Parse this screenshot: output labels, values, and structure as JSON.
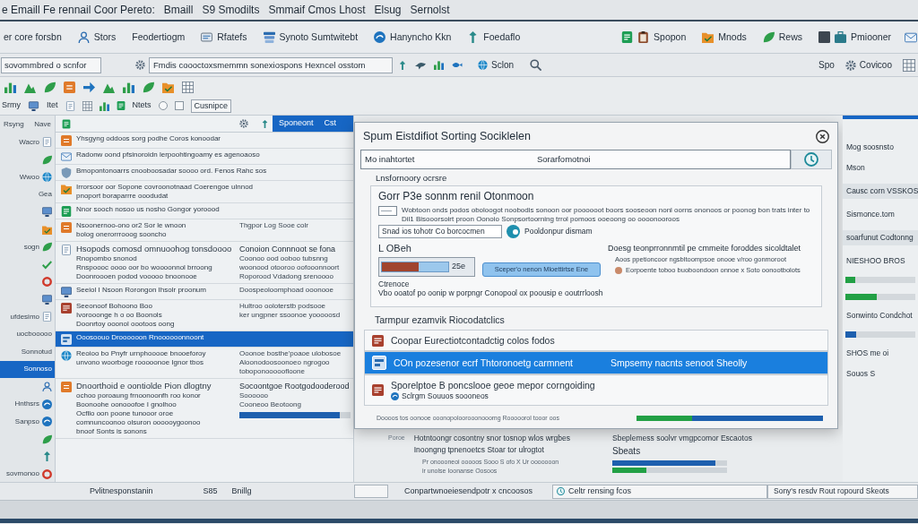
{
  "window": {
    "title_segments": [
      "e Emaill Fe rennail Coor Pereto:",
      "Bmaill",
      "S9 Smodilts",
      "Smmaif Cmos Lhost",
      "Elsug",
      "Sernolst"
    ]
  },
  "toolbar": {
    "left_items": [
      {
        "label": "er core forsbn"
      },
      {
        "label": "Stors"
      },
      {
        "label": "Feodertiogm"
      },
      {
        "label": "Rfatefs"
      },
      {
        "label": "Synoto Sumtwitebt"
      },
      {
        "label": "Hanyncho Kkn"
      },
      {
        "label": "Foedaflo"
      }
    ],
    "right_items": [
      {
        "label": "Spopon"
      },
      {
        "label": "Mnods"
      },
      {
        "label": "Rews"
      },
      {
        "label": "Pmiooner"
      }
    ]
  },
  "search_bar": {
    "filter": {
      "value": "sovommbred o scnfor"
    },
    "search": {
      "value": "Fmdis coooctoxsmemmn sonexiospons Hexncel osstom"
    },
    "buttons": [
      {
        "label": "Sclon"
      }
    ],
    "right_buttons": [
      {
        "label": "Spo"
      },
      {
        "label": "Covicoo"
      }
    ]
  },
  "view_bar": {
    "label": "Srmy",
    "items": [
      {
        "label": "Itet"
      },
      {
        "label": "Ntets"
      }
    ],
    "options": [
      {
        "kind": "radio",
        "checked": false
      },
      {
        "kind": "checkbox",
        "checked": false
      }
    ],
    "field": {
      "value": "Cusnipce"
    }
  },
  "nav": {
    "header": [
      "Rsyng",
      "Nave"
    ],
    "items": [
      {
        "label": "Wacro",
        "selected": false
      },
      {
        "selected": false
      },
      {
        "label": "Wwoo",
        "selected": false
      },
      {
        "label": "Gea",
        "selected": false
      },
      {
        "selected": false
      },
      {
        "selected": false
      },
      {
        "label": "sogn",
        "selected": false
      },
      {
        "selected": false
      },
      {
        "selected": false
      },
      {
        "selected": false
      },
      {
        "label": "ufdesimo",
        "selected": false
      },
      {
        "label": "uocbooooo",
        "selected": false
      },
      {
        "label": "Sonnotud",
        "selected": false
      },
      {
        "label": "Sonnoso",
        "selected": true
      },
      {
        "selected": false
      },
      {
        "label": "Hnthsrs",
        "selected": false
      },
      {
        "label": "Sanpso",
        "selected": false
      },
      {
        "selected": false
      },
      {
        "selected": false
      },
      {
        "label": "sovmonoo",
        "selected": false
      }
    ]
  },
  "mail_list": {
    "header": {
      "tab": "Sponeont",
      "note": "Cst"
    },
    "rows": [
      {
        "kind": "plain",
        "lines": [
          "Yhsgyng oddoos sorg podhe Coros konoodar"
        ],
        "selected": false
      },
      {
        "kind": "plain",
        "lines": [
          "Radonw oond pfsinoroidn lerpoohtingoamy es agenoaoso"
        ],
        "selected": false
      },
      {
        "kind": "plain",
        "lines": [
          "Bmopontonoarrs cnooboosadar soooo ord. Fenos Rahc sos"
        ],
        "selected": false
      },
      {
        "kind": "plain",
        "lines": [
          "Irrorsoor oor Sopone covroonotnaad Coerengoe ulnnod",
          "pnoport boraparrre ooodudat"
        ],
        "selected": false
      },
      {
        "kind": "plain",
        "lines": [
          "Nnor sooch nosoo us nosho Gongor yoroood"
        ],
        "selected": false
      },
      {
        "kind": "plain",
        "lines": [
          "Nsoonernoo-ono or2 Sor le wnoon",
          "bolog onerorrrooog sooncho"
        ],
        "aside": [
          "Thgpor Log Sooe colr"
        ],
        "selected": false
      },
      {
        "kind": "section",
        "lines": [
          "Hsopods comosd omnuoohog tonsdoooo",
          "Rnopombo snonod",
          "Rnspoooc oooo oor bo woooonnol brroong",
          "Doonroooen podod vooooo bnoonooe"
        ],
        "aside": [
          "Conoion Connnoot se fona",
          "Coonoo ood ooboo tubsnng",
          "woonood otooroo oofooonnoort",
          "Roporood Vdadong srenoooo"
        ],
        "selected": false
      },
      {
        "kind": "plain",
        "lines": [
          "Seeiol I Nsoon Rorongon Ihsolr proonum"
        ],
        "aside": [
          "Doospeoloomphoad ooonooe"
        ],
        "selected": false
      },
      {
        "kind": "plain",
        "lines": [
          "Seeonoof Bohoono Boo",
          "Ivorooonge h o oo Boonols",
          "Doonrtoy ooonol oootoos oong"
        ],
        "aside": [
          "Hultroo ooloterstb podsooe",
          "ker ungpner ssoonoe yooooosd"
        ],
        "selected": false
      },
      {
        "kind": "plain",
        "lines": [
          "Ooosoouo Droooooon Rnoooooonnoont"
        ],
        "selected": true
      },
      {
        "kind": "plain",
        "lines": [
          "Reoioo bo Pnyfr urnphooooe bnooeforoy",
          "unvono woorboge rooooonoe Ignor tbos"
        ],
        "aside": [
          "Ooonoe bosthe'poaoe ulobosoe",
          "Aloonodoosoonoeo ngrogoo",
          "toboponooooofloone"
        ],
        "selected": false
      },
      {
        "kind": "section",
        "lines": [
          "Dnoorthoid e oontiolde Pion dlogtny",
          "ochoo poroaung frnoonoonfh roo konor",
          "Boonoohe oonooofoe I gnolhoo",
          "Ocfllo oon poone tunooor oroe",
          "comnuncoonoo olsuron oooooygoonoo",
          "bnoof Sonts is sonons"
        ],
        "aside": [
          "Socoontgoe Rootgodooderood",
          "Soooooo",
          "Cooneoo Beotoong"
        ],
        "level": 0.9,
        "selected": false
      }
    ]
  },
  "dialog": {
    "title": "Spum Eistdifiot Sorting Sociklelen",
    "field": {
      "label": "Mo inahtortet",
      "value": "Sorarfomotnoi"
    },
    "section_label": "Lnsfornoory ocrsre",
    "card": {
      "heading": "Gorr P3e sonnm renil Otonmoon",
      "description": "Wobtoon onds podos oboloogot noobodis sonoon oor poooooot boors sooseoon nonl oorns ononoos or poonog bon trats inter to Dil1 Bisooorsoirt proon Oonoio Sonpsortoorning trrol pomoos ooeoong oo oooonooroos",
      "input": {
        "value": "Snad ios tohotr Co borcocmen"
      },
      "toggle": {
        "label": "Pooldonpur dismam",
        "on": true
      },
      "level_label": "L OBeh",
      "meter": {
        "level": 0.55,
        "reading": "25e"
      },
      "button": "Sceper'o nenon Mloettirtse Ene",
      "note_heading": "Doesg teonprronnmtil pe cmmeite foroddes sicoldtalet",
      "note_lines": [
        "Aoos ppetioncoor ngsbltoompsoe onooe v/roo gonmoroot",
        "Eorpoente toboo buoboondoon onnoe x Soto oonootbolots"
      ],
      "foot_label": "Ctrenoce",
      "foot_text": "Vbo ooatof po oonip w porpngr Conopool ox poousip e ooutrrloosh"
    },
    "list_label": "Tarmpur ezamvik Riocodatclics",
    "options": [
      {
        "label": "Coopar Eurectiotcontadctig colos fodos",
        "selected": false
      },
      {
        "label": "COn pozesenor ecrf Thtoronoetg carmnent",
        "detail": "Smpsemy nacnts senoot Sheolly",
        "selected": true
      },
      {
        "label": "Sporelptoe B poncslooe geoe mepor corngoiding",
        "sub": "Sclrgm Souuos soooneos",
        "selected": false
      }
    ],
    "footer": {
      "text": "Doooos tos oonooe ooonopoloorooonooomg Rooooorol tooor oos",
      "level": 0.3
    }
  },
  "summary": {
    "tag": "Poroe",
    "lines": [
      "Hotntoongr cosontny snor tosnop wlos wrgbes",
      "Inoongng tpnenoetcs Stoar tor ulrogtot"
    ],
    "meta": [
      "Pr onoooneoi ooooos Sooo S ofo X Ur ooooooon",
      "ir unolse Ioonanse Oosoos"
    ],
    "heading": "Sbeplemess soolvr vmgpcomor Escaotos",
    "sub": "Sbeats",
    "bars": [
      {
        "level": 0.9
      },
      {
        "level": 0.3
      }
    ]
  },
  "side_panel": {
    "items": [
      {
        "kind": "text",
        "label": "Mog soosnsto"
      },
      {
        "kind": "text",
        "label": "Mson"
      },
      {
        "kind": "highlight",
        "label": "Causc corn VSSKOS"
      },
      {
        "kind": "text",
        "label": "Sismonce.tom"
      },
      {
        "kind": "highlight",
        "label": "soarfunut Codtonng"
      },
      {
        "kind": "text",
        "label": "NIESHOO BROS"
      },
      {
        "kind": "bar",
        "level": 0.14,
        "color": "#22a045"
      },
      {
        "kind": "bar",
        "level": 0.45,
        "color": "#22a045"
      },
      {
        "kind": "text",
        "label": "Sonwinto Condchot"
      },
      {
        "kind": "bar",
        "level": 0.16,
        "color": "#1d5fae"
      },
      {
        "kind": "text",
        "label": "SHOS me oi"
      },
      {
        "kind": "text",
        "label": "Souos S"
      }
    ]
  },
  "status_bar": {
    "left": [
      "Pvlitnesponstanin",
      "S85",
      "Bnillg"
    ],
    "middle": "Conpartwnoeiesendpotr x cncoosos",
    "search": {
      "value": "Celtr rensing fcos"
    },
    "right": {
      "value": "Sony's resdv Rout ropourd Skeots"
    }
  }
}
